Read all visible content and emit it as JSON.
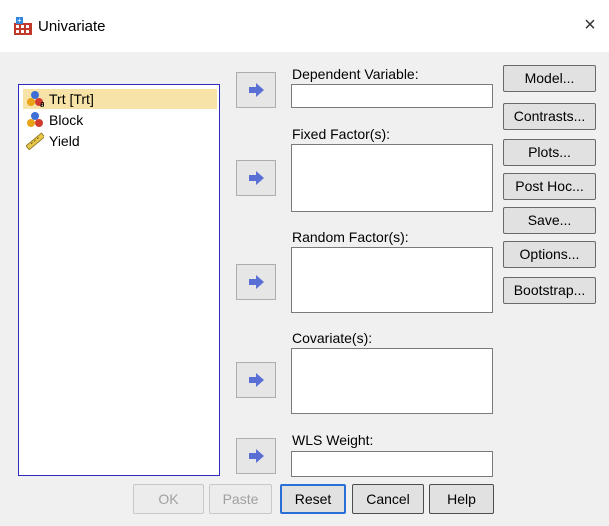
{
  "window": {
    "title": "Univariate",
    "close_glyph": "×"
  },
  "variables": [
    {
      "label": "Trt [Trt]",
      "icon": "nominal-variable-icon",
      "selected": true
    },
    {
      "label": "Block",
      "icon": "nominal-variable-icon",
      "selected": false
    },
    {
      "label": "Yield",
      "icon": "scale-variable-icon",
      "selected": false
    }
  ],
  "fields": {
    "dependent": {
      "label": "Dependent Variable:"
    },
    "fixed": {
      "label": "Fixed Factor(s):"
    },
    "random": {
      "label": "Random Factor(s):"
    },
    "covariate": {
      "label": "Covariate(s):"
    },
    "wls": {
      "label": "WLS Weight:"
    }
  },
  "side_buttons": {
    "model": "Model...",
    "contrasts": "Contrasts...",
    "plots": "Plots...",
    "post_hoc": "Post Hoc...",
    "save": "Save...",
    "options": "Options...",
    "bootstrap": "Bootstrap..."
  },
  "bottom_buttons": {
    "ok": "OK",
    "paste": "Paste",
    "reset": "Reset",
    "cancel": "Cancel",
    "help": "Help"
  },
  "colors": {
    "list_border": "#2b2bb8",
    "selection": "#f7e3a7",
    "arrow": "#5a6fd6",
    "default_button_border": "#2a6fd6"
  }
}
